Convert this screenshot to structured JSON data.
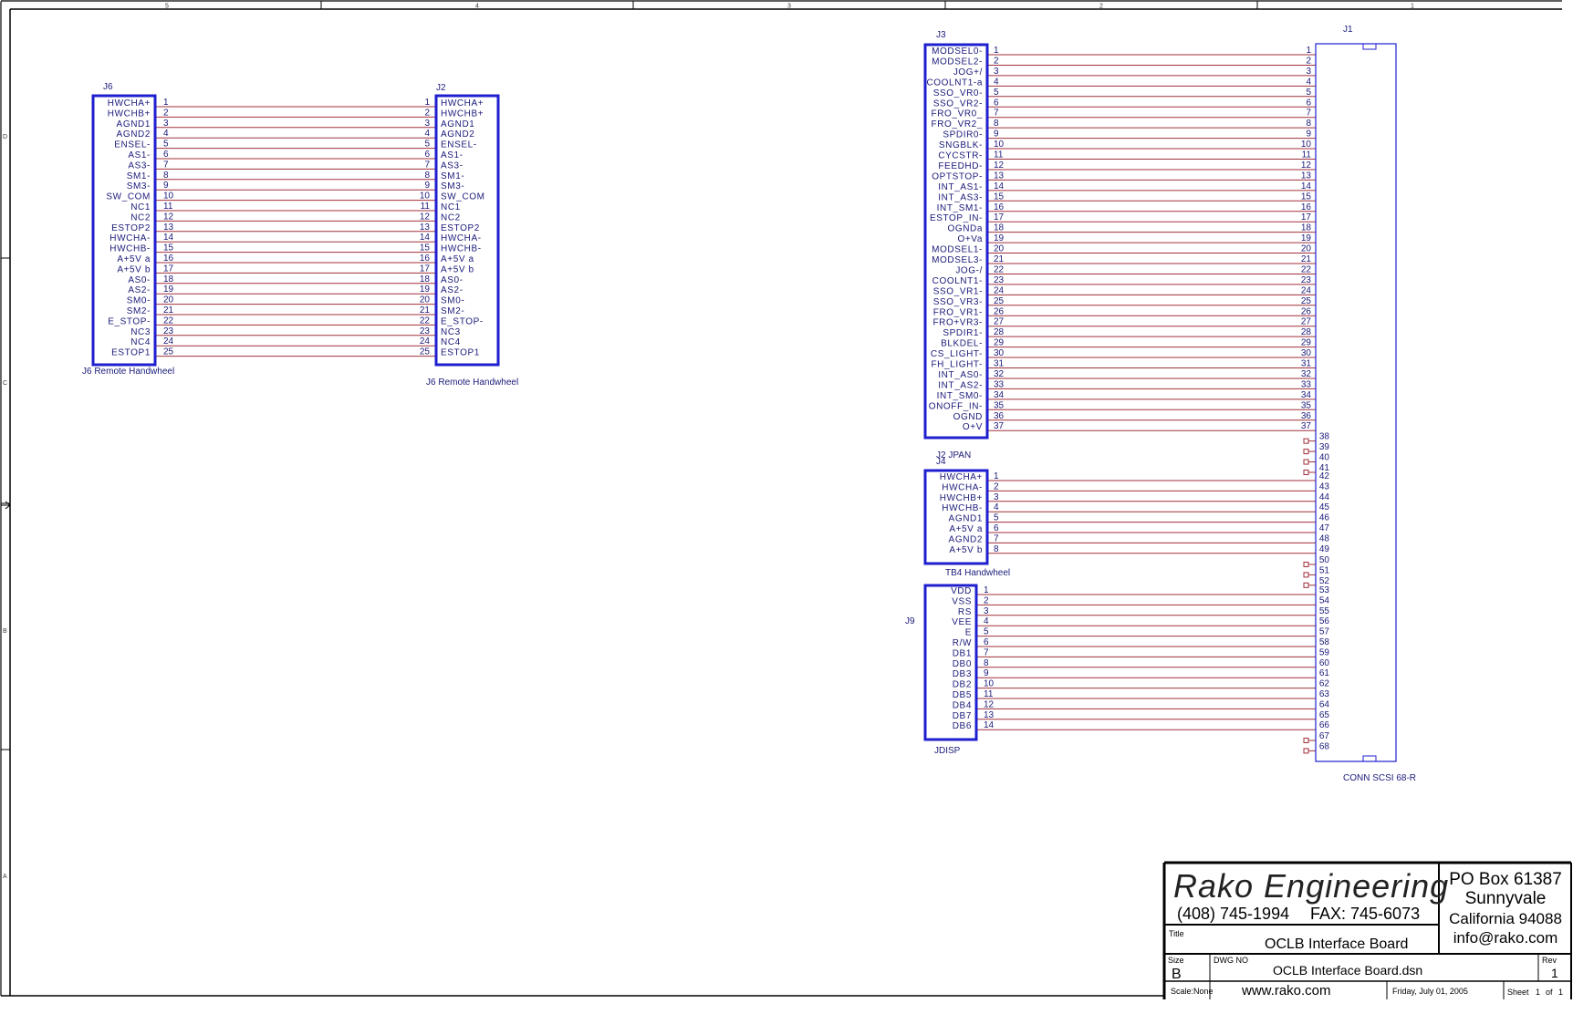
{
  "border": {
    "columns": [
      "5",
      "4",
      "3",
      "2",
      "1"
    ],
    "rows": [
      "D",
      "C",
      "B",
      "A"
    ]
  },
  "title_block": {
    "company": "Rako Engineering",
    "phone": "(408) 745-1994",
    "fax": "FAX: 745-6073",
    "address": [
      "PO Box 61387",
      "Sunnyvale",
      "California 94088",
      "info@rako.com"
    ],
    "title_label": "Title",
    "title": "OCLB Interface Board",
    "size_label": "Size",
    "size": "B",
    "dwg_label": "DWG NO",
    "dwg_no": "OCLB Interface Board.dsn",
    "rev_label": "Rev",
    "rev": "1",
    "scale": "Scale:None",
    "website": "www.rako.com",
    "date": "Friday, July 01, 2005",
    "sheet_label": "Sheet",
    "sheet_num": "1",
    "of_label": "of",
    "sheet_total": "1"
  },
  "connectors": {
    "J6": {
      "ref": "J6",
      "caption": "J6 Remote Handwheel",
      "pins": [
        "HWCHA+",
        "HWCHB+",
        "AGND1",
        "AGND2",
        "ENSEL-",
        "AS1-",
        "AS3-",
        "SM1-",
        "SM3-",
        "SW_COM",
        "NC1",
        "NC2",
        "ESTOP2",
        "HWCHA-",
        "HWCHB-",
        "A+5V a",
        "A+5V b",
        "AS0-",
        "AS2-",
        "SM0-",
        "SM2-",
        "E_STOP-",
        "NC3",
        "NC4",
        "ESTOP1"
      ]
    },
    "J2": {
      "ref": "J2",
      "caption": "J6 Remote Handwheel",
      "pins": [
        "HWCHA+",
        "HWCHB+",
        "AGND1",
        "AGND2",
        "ENSEL-",
        "AS1-",
        "AS3-",
        "SM1-",
        "SM3-",
        "SW_COM",
        "NC1",
        "NC2",
        "ESTOP2",
        "HWCHA-",
        "HWCHB-",
        "A+5V a",
        "A+5V b",
        "AS0-",
        "AS2-",
        "SM0-",
        "SM2-",
        "E_STOP-",
        "NC3",
        "NC4",
        "ESTOP1"
      ]
    },
    "J3": {
      "ref": "J3",
      "caption": "J2 JPAN",
      "pins": [
        "MODSEL0-",
        "MODSEL2-",
        "JOG+/",
        "COOLNT1-a",
        "SSO_VR0-",
        "SSO_VR2-",
        "FRO_VR0_",
        "FRO_VR2_",
        "SPDIR0-",
        "SNGBLK-",
        "CYCSTR-",
        "FEEDHD-",
        "OPTSTOP-",
        "INT_AS1-",
        "INT_AS3-",
        "INT_SM1-",
        "ESTOP_IN-",
        "OGNDa",
        "O+Va",
        "MODSEL1-",
        "MODSEL3-",
        "JOG-/",
        "COOLNT1-",
        "SSO_VR1-",
        "SSO_VR3-",
        "FRO_VR1-",
        "FRO+VR3-",
        "SPDIR1-",
        "BLKDEL-",
        "CS_LIGHT-",
        "FH_LIGHT-",
        "INT_AS0-",
        "INT_AS2-",
        "INT_SM0-",
        "ONOFF_IN-",
        "OGND",
        "O+V"
      ]
    },
    "J4": {
      "ref": "J4",
      "caption": "TB4 Handwheel",
      "pins": [
        "HWCHA+",
        "HWCHA-",
        "HWCHB+",
        "HWCHB-",
        "AGND1",
        "A+5V a",
        "AGND2",
        "A+5V b"
      ]
    },
    "J9": {
      "ref": "J9",
      "caption": "JDISP",
      "pins": [
        "VDD",
        "VSS",
        "RS",
        "VEE",
        "E",
        "R/W",
        "DB1",
        "DB0",
        "DB3",
        "DB2",
        "DB5",
        "DB4",
        "DB7",
        "DB6"
      ]
    },
    "J1": {
      "ref": "J1",
      "caption": "CONN SCSI 68-R",
      "pin_count": 68
    }
  },
  "colors": {
    "component": "#1f1fcf",
    "wire": "#a0303a",
    "text": "#1a1a7a",
    "border": "#000000"
  }
}
